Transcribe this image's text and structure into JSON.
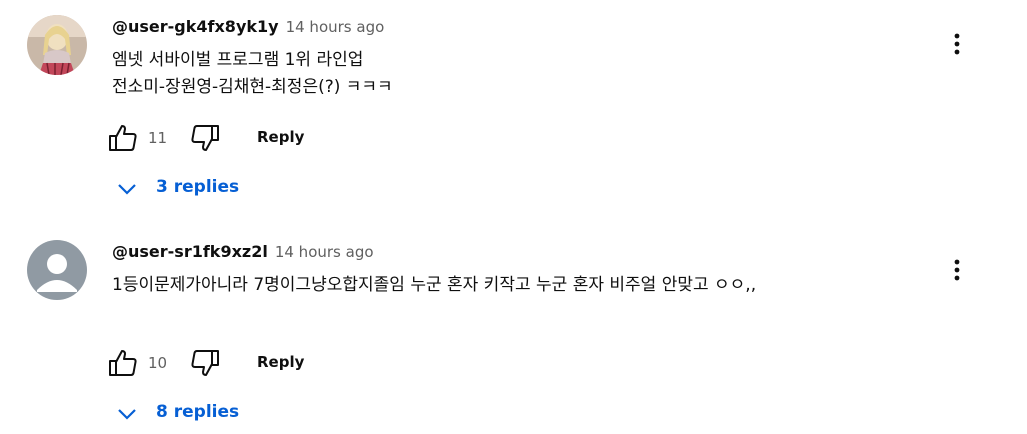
{
  "comments": [
    {
      "author": "@user-gk4fx8yk1y",
      "time": "14 hours ago",
      "text": "엠넷 서바이벌 프로그램 1위 라인업\n전소미-장원영-김채현-최정은(?) ㅋㅋㅋ",
      "likes": "11",
      "reply_label": "Reply",
      "replies_label": "3 replies",
      "avatar": "photo-avatar"
    },
    {
      "author": "@user-sr1fk9xz2l",
      "time": "14 hours ago",
      "text": "1등이문제가아니라 7명이그냥오합지졸임 누군 혼자 키작고 누군 혼자 비주얼 안맞고 ㅇㅇ,,",
      "likes": "10",
      "reply_label": "Reply",
      "replies_label": "8 replies",
      "avatar": "default-avatar"
    }
  ],
  "icons": {
    "like": "thumbs-up-icon",
    "dislike": "thumbs-down-icon",
    "menu": "more-vert-icon",
    "expand": "chevron-down-icon"
  },
  "colors": {
    "link": "#065fd4",
    "secondary_text": "#606060",
    "default_avatar_bg": "#909aa3"
  }
}
